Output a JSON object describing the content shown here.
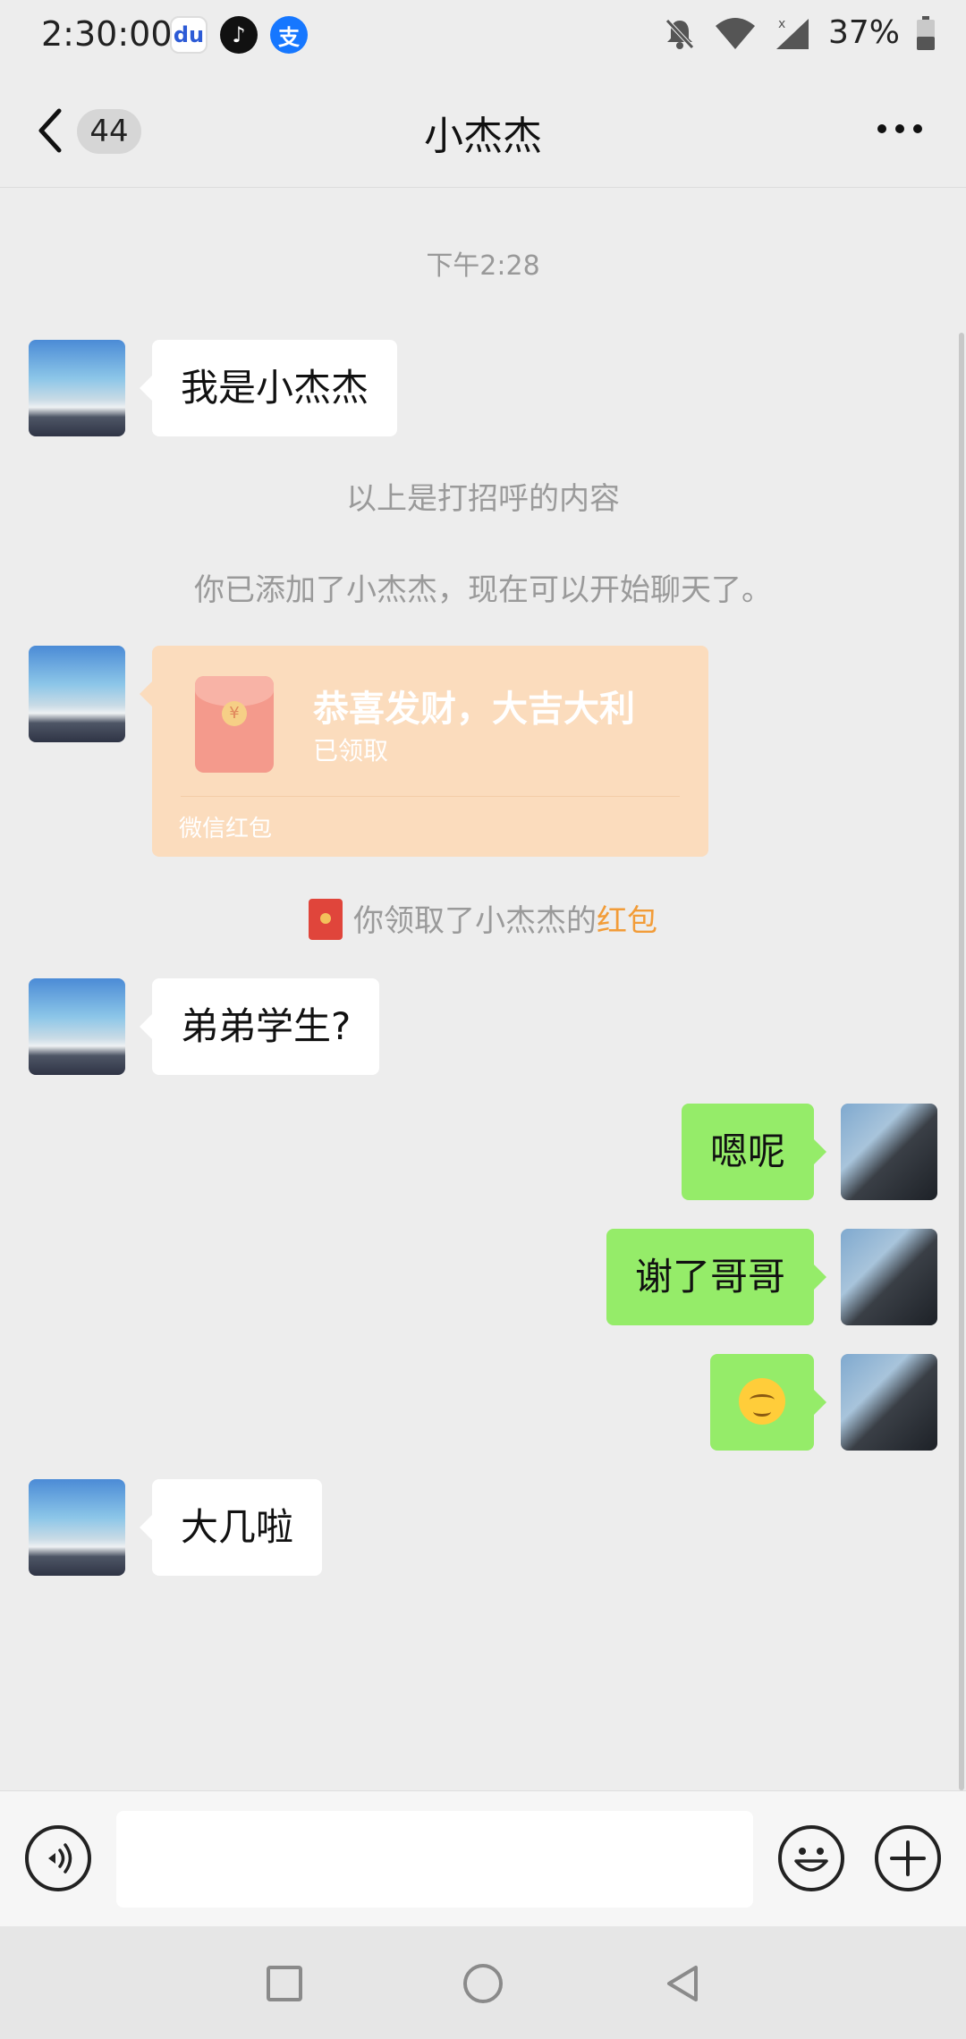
{
  "status_bar": {
    "time": "2:30:00",
    "apps": [
      "baidu-icon",
      "douyin-icon",
      "alipay-icon"
    ],
    "battery": "37%"
  },
  "header": {
    "unread_count": "44",
    "title": "小杰杰"
  },
  "messages": {
    "timestamp": "下午2:28",
    "m1": "我是小杰杰",
    "greeting_note": "以上是打招呼的内容",
    "added_note": "你已添加了小杰杰，现在可以开始聊天了。",
    "red_packet": {
      "title": "恭喜发财，大吉大利",
      "status": "已领取",
      "footer": "微信红包",
      "color": "#fbdcbd"
    },
    "rp_notice_prefix": "你领取了小杰杰的",
    "rp_notice_link": "红包",
    "m2": "弟弟学生?",
    "m3": "嗯呢",
    "m4": "谢了哥哥",
    "m5_emoji": "smiling-face-emoji",
    "m6": "大几啦"
  },
  "colors": {
    "background": "#ededed",
    "sent_bubble": "#95ec69",
    "received_bubble": "#ffffff",
    "link": "#f29c38"
  },
  "input_bar": {
    "value": "",
    "placeholder": ""
  }
}
